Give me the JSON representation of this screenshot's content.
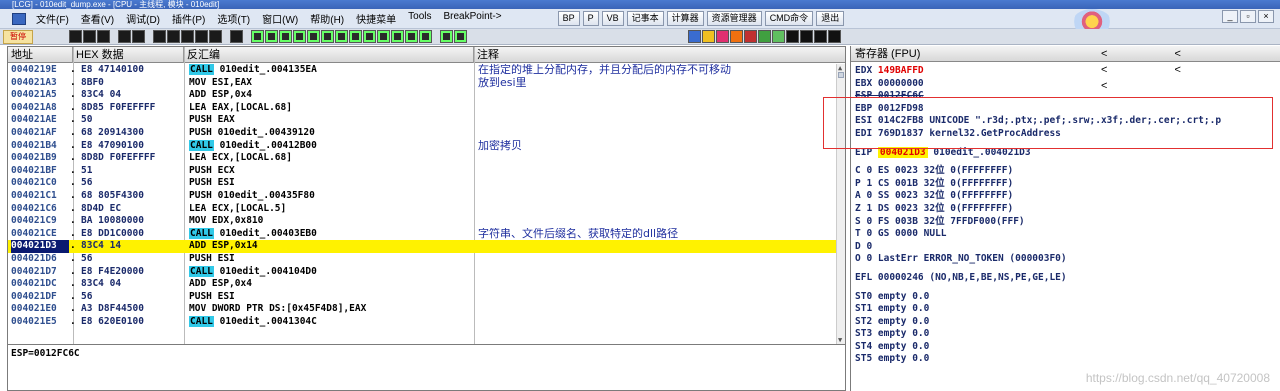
{
  "title": "[LCG] - 010edit_dump.exe - [CPU - 主线程, 模块 - 010edit]",
  "menu": [
    "文件(F)",
    "查看(V)",
    "调试(D)",
    "插件(P)",
    "选项(T)",
    "窗口(W)",
    "帮助(H)",
    "快捷菜单",
    "Tools",
    "BreakPoint->"
  ],
  "top_buttons": [
    "BP",
    "P",
    "VB",
    "记事本",
    "计算器",
    "资源管理器",
    "CMD命令",
    "退出"
  ],
  "toolbar": {
    "warn_label": "暂停"
  },
  "cpu": {
    "headers": {
      "addr": "地址",
      "hex": "HEX 数据",
      "asm": "反汇编",
      "comment": "注释"
    },
    "rows": [
      {
        "addr": "0040219E",
        "mark": ".",
        "hex": "E8 47140100",
        "call": "CALL",
        "asm": "010edit_.004135EA",
        "comment": "在指定的堆上分配内存，并且分配后的内存不可移动"
      },
      {
        "addr": "004021A3",
        "mark": ".",
        "hex": "8BF0",
        "call": "",
        "asm": "MOV ESI,EAX",
        "comment": "放到esi里"
      },
      {
        "addr": "004021A5",
        "mark": ".",
        "hex": "83C4 04",
        "call": "",
        "asm": "ADD ESP,0x4",
        "comment": ""
      },
      {
        "addr": "004021A8",
        "mark": ".",
        "hex": "8D85 F0FEFFFF",
        "call": "",
        "asm": "LEA EAX,[LOCAL.68]",
        "comment": ""
      },
      {
        "addr": "004021AE",
        "mark": ".",
        "hex": "50",
        "call": "",
        "asm": "PUSH EAX",
        "comment": ""
      },
      {
        "addr": "004021AF",
        "mark": ".",
        "hex": "68 20914300",
        "call": "",
        "asm": "PUSH 010edit_.00439120",
        "comment": ""
      },
      {
        "addr": "004021B4",
        "mark": ".",
        "hex": "E8 47090100",
        "call": "CALL",
        "asm": "010edit_.00412B00",
        "comment": "加密拷贝"
      },
      {
        "addr": "004021B9",
        "mark": ".",
        "hex": "8D8D F0FEFFFF",
        "call": "",
        "asm": "LEA ECX,[LOCAL.68]",
        "comment": ""
      },
      {
        "addr": "004021BF",
        "mark": ".",
        "hex": "51",
        "call": "",
        "asm": "PUSH ECX",
        "comment": ""
      },
      {
        "addr": "004021C0",
        "mark": ".",
        "hex": "56",
        "call": "",
        "asm": "PUSH ESI",
        "comment": ""
      },
      {
        "addr": "004021C1",
        "mark": ".",
        "hex": "68 805F4300",
        "call": "",
        "asm": "PUSH 010edit_.00435F80",
        "comment": ""
      },
      {
        "addr": "004021C6",
        "mark": ".",
        "hex": "8D4D EC",
        "call": "",
        "asm": "LEA ECX,[LOCAL.5]",
        "comment": ""
      },
      {
        "addr": "004021C9",
        "mark": ".",
        "hex": "BA 10080000",
        "call": "",
        "asm": "MOV EDX,0x810",
        "comment": ""
      },
      {
        "addr": "004021CE",
        "mark": ".",
        "hex": "E8 DD1C0000",
        "call": "CALL",
        "asm": "010edit_.00403EB0",
        "comment": "字符串、文件后缀名、获取特定的dll路径"
      },
      {
        "addr": "004021D3",
        "mark": ".",
        "hex": "83C4 14",
        "call": "",
        "asm": "ADD ESP,0x14",
        "comment": "",
        "selected": true
      },
      {
        "addr": "004021D6",
        "mark": ".",
        "hex": "56",
        "call": "",
        "asm": "PUSH ESI",
        "comment": ""
      },
      {
        "addr": "004021D7",
        "mark": ".",
        "hex": "E8 F4E20000",
        "call": "CALL",
        "asm": "010edit_.004104D0",
        "comment": ""
      },
      {
        "addr": "004021DC",
        "mark": ".",
        "hex": "83C4 04",
        "call": "",
        "asm": "ADD ESP,0x4",
        "comment": ""
      },
      {
        "addr": "004021DF",
        "mark": ".",
        "hex": "56",
        "call": "",
        "asm": "PUSH ESI",
        "comment": ""
      },
      {
        "addr": "004021E0",
        "mark": ".",
        "hex": "A3 D8F44500",
        "call": "",
        "asm": "MOV DWORD PTR DS:[0x45F4D8],EAX",
        "comment": ""
      },
      {
        "addr": "004021E5",
        "mark": ".",
        "hex": "E8 620E0100",
        "call": "CALL",
        "asm": "010edit_.0041304C",
        "comment": ""
      }
    ],
    "status_line": "ESP=0012FC6C"
  },
  "registers": {
    "header": "寄存器 (FPU)",
    "header_arrows": "< < < < <",
    "lines": [
      {
        "text": "EDX ",
        "red": "149BAFFD",
        "rest": ""
      },
      {
        "text": "EBX 00000000",
        "red": "",
        "rest": ""
      },
      {
        "text": "ESP 0012FC6C",
        "red": "",
        "rest": "",
        "strike": true
      },
      {
        "text": "EBP 0012FD98",
        "red": "",
        "rest": ""
      },
      {
        "text": "ESI 014C2FB8 UNICODE \".r3d;.ptx;.pef;.srw;.x3f;.der;.cer;.crt;.p",
        "red": "",
        "rest": ""
      },
      {
        "text": "EDI 769D1837 kernel32.GetProcAddress",
        "red": "",
        "rest": ""
      }
    ],
    "eip": {
      "label": "EIP ",
      "value": "004021D3",
      "rest": " 010edit_.004021D3"
    },
    "flags": [
      "C 0  ES 0023 32位 0(FFFFFFFF)",
      "P 1  CS 001B 32位 0(FFFFFFFF)",
      "A 0  SS 0023 32位 0(FFFFFFFF)",
      "Z 1  DS 0023 32位 0(FFFFFFFF)",
      "S 0  FS 003B 32位 7FFDF000(FFF)",
      "T 0  GS 0000 NULL",
      "D 0",
      "O 0  LastErr ERROR_NO_TOKEN (000003F0)"
    ],
    "efl": "EFL 00000246 (NO,NB,E,BE,NS,PE,GE,LE)",
    "fpu": [
      "ST0 empty 0.0",
      "ST1 empty 0.0",
      "ST2 empty 0.0",
      "ST3 empty 0.0",
      "ST4 empty 0.0",
      "ST5 empty 0.0"
    ]
  },
  "watermark": "https://blog.csdn.net/qq_40720008"
}
